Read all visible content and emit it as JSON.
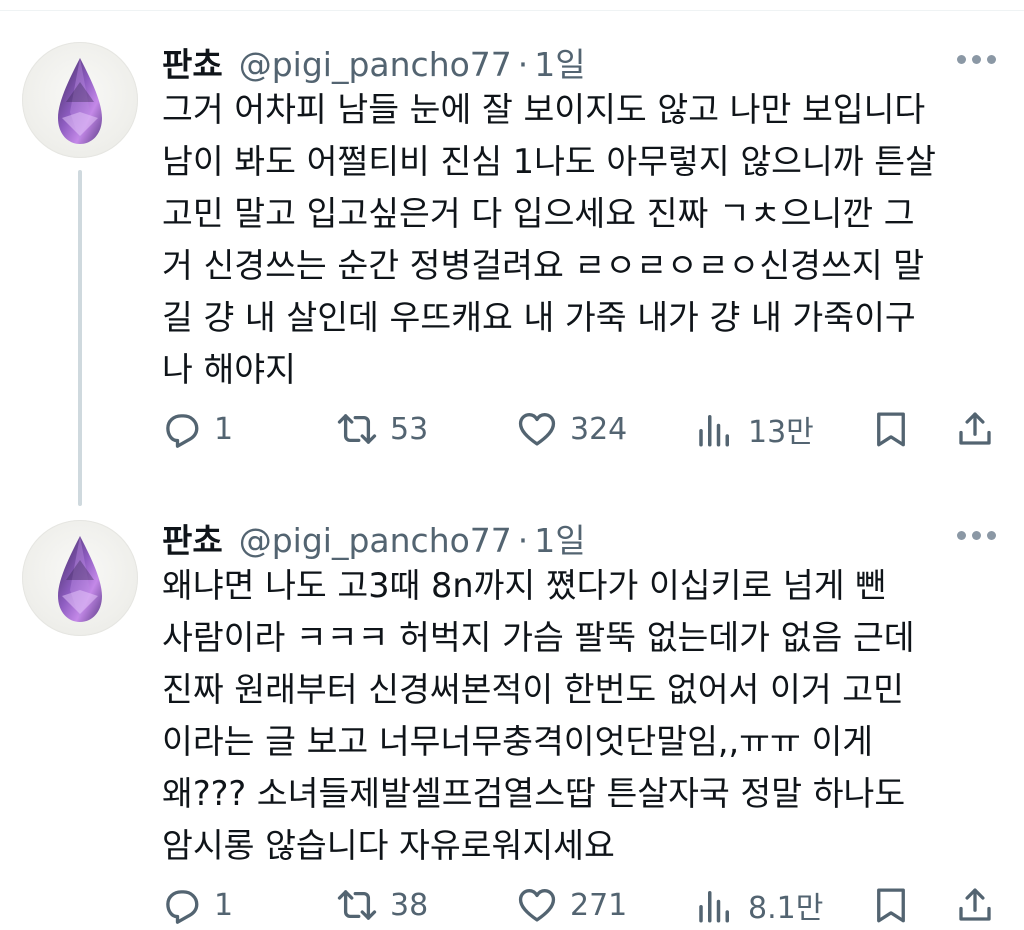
{
  "tweets": [
    {
      "author": {
        "name": "판쵸",
        "handle": "@pigi_pancho77"
      },
      "separator": "·",
      "time": "1일",
      "body_lines": [
        "그거 어차피 남들 눈에 잘 보이지도 않고 나만 보입니다",
        "남이 봐도 어쩔티비 진심 1나도 아무렇지 않으니까 튼살",
        "고민 말고 입고싶은거 다 입으세요 진짜 ㄱㅊ으니깐 그",
        "거 신경쓰는 순간 정병걸려요 ㄹㅇㄹㅇㄹㅇ신경쓰지 말",
        "길 걍 내 살인데 우뜨캐요 내 가죽 내가 걍 내 가죽이구",
        "나 해야지"
      ],
      "stats": {
        "replies": "1",
        "retweets": "53",
        "likes": "324",
        "views": "13만"
      }
    },
    {
      "author": {
        "name": "판쵸",
        "handle": "@pigi_pancho77"
      },
      "separator": "·",
      "time": "1일",
      "body_lines": [
        "왜냐면 나도 고3때 8n까지 쪘다가 이십키로 넘게 뺀",
        "사람이라 ㅋㅋㅋ 허벅지 가슴 팔뚝 없는데가 없음 근데",
        "진짜 원래부터 신경써본적이 한번도 없어서 이거 고민",
        "이라는 글 보고 너무너무충격이엇단말임,,ㅠㅠ 이게",
        "왜??? 소녀들제발셀프검열스땁 튼살자국 정말 하나도",
        "암시롱 않습니다 자유로워지세요"
      ],
      "stats": {
        "replies": "1",
        "retweets": "38",
        "likes": "271",
        "views": "8.1만"
      }
    }
  ],
  "icons": {
    "reply": "reply-icon",
    "retweet": "retweet-icon",
    "like": "heart-icon",
    "views": "views-chart-icon",
    "bookmark": "bookmark-icon",
    "share": "share-icon",
    "more": "more-dots-icon",
    "avatar": "amethyst-gem-avatar"
  },
  "colors": {
    "text": "#0f1419",
    "secondary": "#536471",
    "thread_line": "#cfd9de",
    "avatar_gem": "#9c6bc4"
  }
}
